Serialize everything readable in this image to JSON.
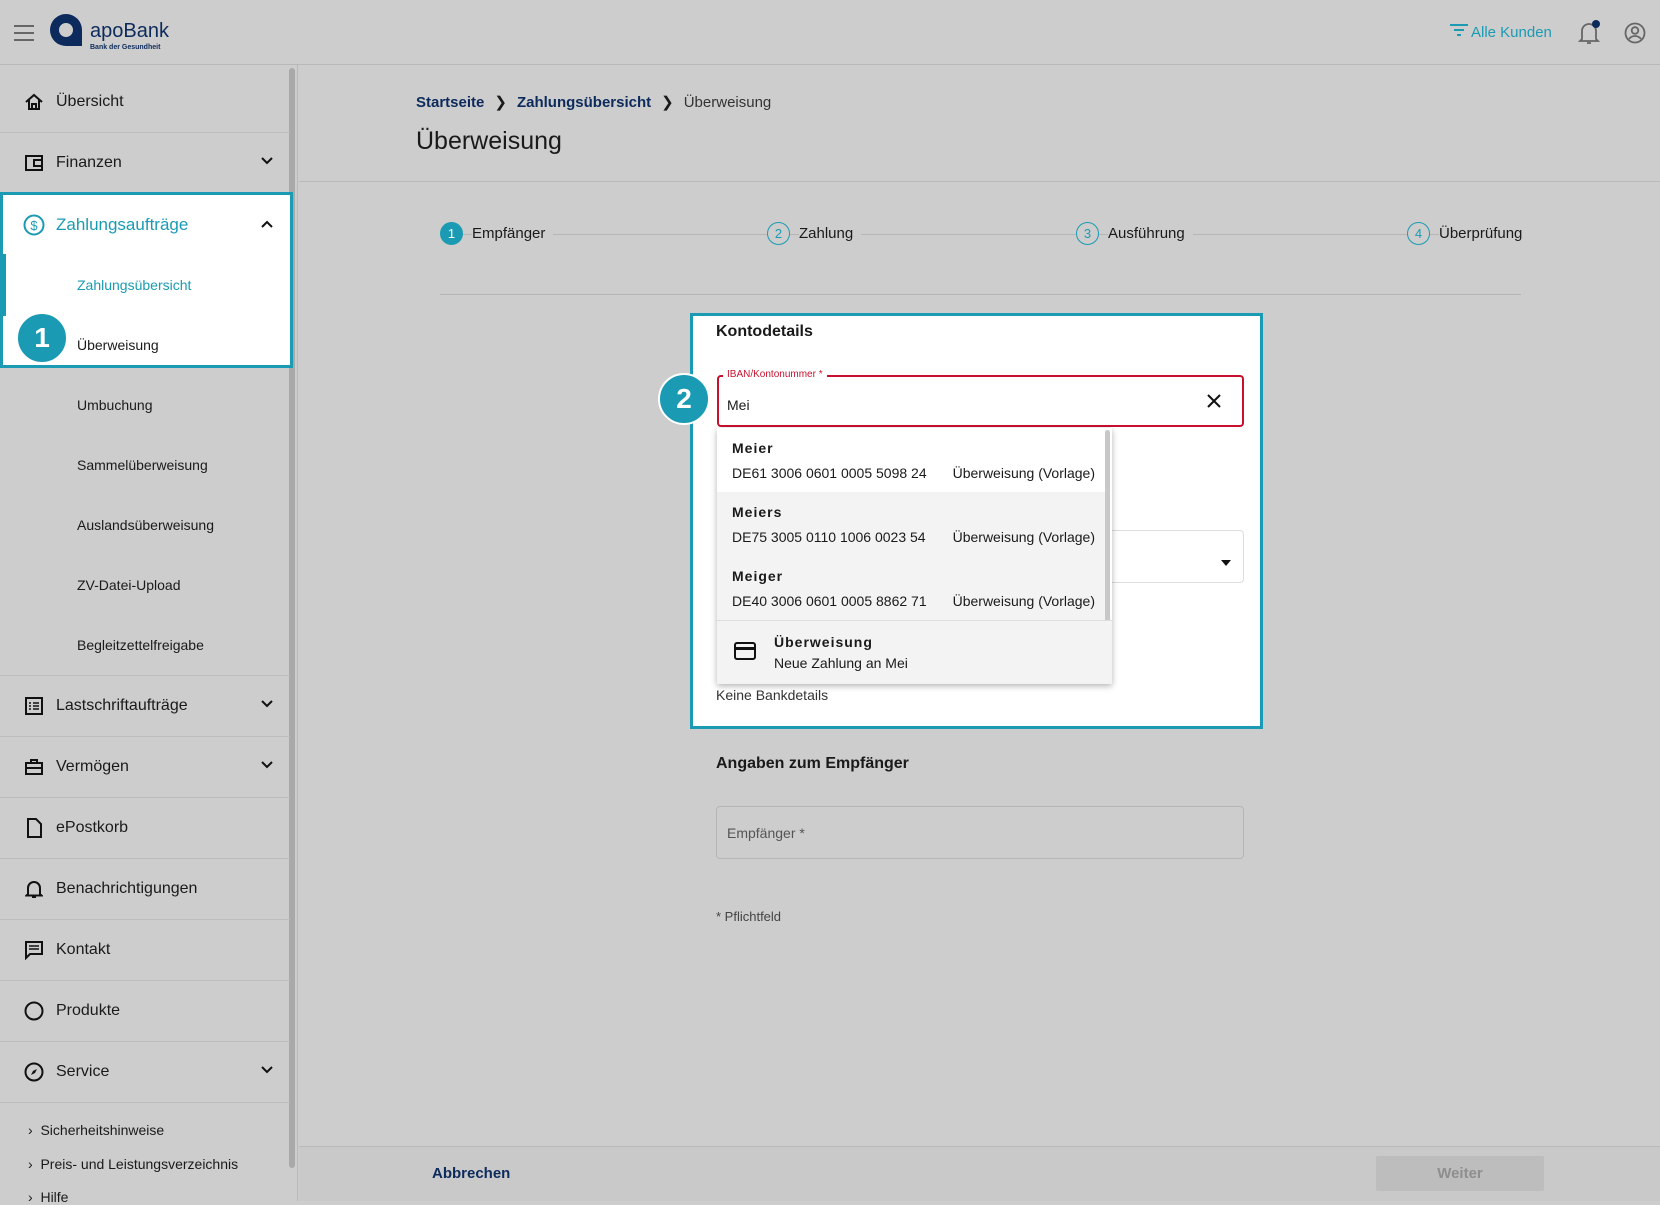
{
  "header": {
    "logo_text": "apoBank",
    "logo_tagline": "Bank der Gesundheit",
    "filter_label": "Alle Kunden"
  },
  "sidebar": {
    "items": [
      {
        "label": "Übersicht"
      },
      {
        "label": "Finanzen"
      },
      {
        "label": "Zahlungsaufträge"
      },
      {
        "label": "Lastschriftaufträge"
      },
      {
        "label": "Vermögen"
      },
      {
        "label": "ePostkorb"
      },
      {
        "label": "Benachrichtigungen"
      },
      {
        "label": "Kontakt"
      },
      {
        "label": "Produkte"
      },
      {
        "label": "Service"
      }
    ],
    "sub_items": [
      {
        "label": "Zahlungsübersicht"
      },
      {
        "label": "Überweisung"
      },
      {
        "label": "Umbuchung"
      },
      {
        "label": "Sammelüberweisung"
      },
      {
        "label": "Auslandsüberweisung"
      },
      {
        "label": "ZV-Datei-Upload"
      },
      {
        "label": "Begleitzettelfreigabe"
      }
    ],
    "links": [
      {
        "label": "Sicherheitshinweise"
      },
      {
        "label": "Preis- und Leistungsverzeichnis"
      },
      {
        "label": "Hilfe"
      }
    ]
  },
  "breadcrumb": [
    "Startseite",
    "Zahlungsübersicht",
    "Überweisung"
  ],
  "page_title": "Überweisung",
  "steps": [
    {
      "num": "1",
      "label": "Empfänger"
    },
    {
      "num": "2",
      "label": "Zahlung"
    },
    {
      "num": "3",
      "label": "Ausführung"
    },
    {
      "num": "4",
      "label": "Überprüfung"
    }
  ],
  "form": {
    "section1": "Kontodetails",
    "iban_label": "IBAN/Kontonummer *",
    "iban_value": "Mei",
    "no_bank": "Keine Bankdetails",
    "section2": "Angaben zum Empfänger",
    "recipient_placeholder": "Empfänger *",
    "required_note": "* Pflichtfeld"
  },
  "suggestions": [
    {
      "name": "Meier",
      "iban": "DE61 3006 0601 0005 5098 24",
      "type": "Überweisung (Vorlage)"
    },
    {
      "name": "Meiers",
      "iban": "DE75 3005 0110 1006 0023 54",
      "type": "Überweisung (Vorlage)"
    },
    {
      "name": "Meiger",
      "iban": "DE40 3006 0601 0005 8862 71",
      "type": "Überweisung (Vorlage)"
    }
  ],
  "new_payment": {
    "title": "Überweisung",
    "subtitle": "Neue Zahlung an Mei"
  },
  "footer": {
    "cancel": "Abbrechen",
    "next": "Weiter"
  },
  "annotations": [
    "1",
    "2"
  ],
  "colors": {
    "accent": "#1a9bb3",
    "brand": "#0d2a5c",
    "error": "#c8102e"
  }
}
